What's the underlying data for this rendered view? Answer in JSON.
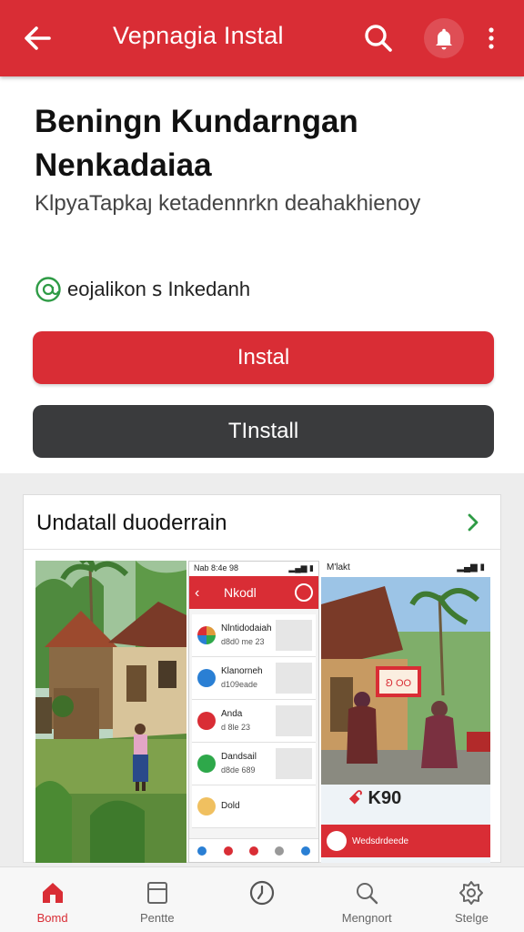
{
  "topbar": {
    "title": "Vepnagia Instal",
    "back_icon": "arrow-left-icon",
    "search_icon": "search-icon",
    "bell_icon": "bell-icon",
    "more_icon": "more-vertical-icon",
    "color": "#d92d35"
  },
  "app": {
    "title_line1": "Beningn Kundarngan",
    "title_line2": "Nenkadaiaa",
    "subtitle": "KlpyaTapkaȷ ketadennrkn deahakhienoy",
    "developer": "eojalikon ꜱ Inkedanh",
    "developer_icon": "developer-at-icon"
  },
  "buttons": {
    "install": "Instal",
    "tinstall": "TInstall",
    "install_color": "#d92d35",
    "tinstall_color": "#3a3b3d"
  },
  "screenshots": {
    "title": "Undatall duoderrain",
    "chevron_icon": "chevron-right-icon",
    "shot2": {
      "status_time": "Nab 8:4e 98",
      "header": "Nkodl",
      "items": [
        {
          "name": "Nlntidodaiah",
          "meta": "d8d0 me 23",
          "color": "#e09a3a"
        },
        {
          "name": "Klanorneh",
          "meta": "d109eade",
          "color": "#2a7fd4"
        },
        {
          "name": "Anda",
          "meta": "d 8le 23",
          "color": "#d92d35"
        },
        {
          "name": "Dandsail",
          "meta": "d8de 689",
          "color": "#2ea84a"
        },
        {
          "name": "Dold",
          "meta": "",
          "color": "#f0c060"
        }
      ]
    },
    "shot3": {
      "status_title": "M'lakt",
      "sign": "Ꞝ OO",
      "logo": "K90",
      "bottom_text": "Wedsdrdeede"
    }
  },
  "bottom_nav": [
    {
      "label": "Bomd",
      "icon": "home-icon",
      "active": true
    },
    {
      "label": "Pentte",
      "icon": "document-icon",
      "active": false
    },
    {
      "label": "",
      "icon": "clock-icon",
      "active": false
    },
    {
      "label": "Mengnort",
      "icon": "search-icon",
      "active": false
    },
    {
      "label": "Stelge",
      "icon": "settings-icon",
      "active": false
    }
  ]
}
